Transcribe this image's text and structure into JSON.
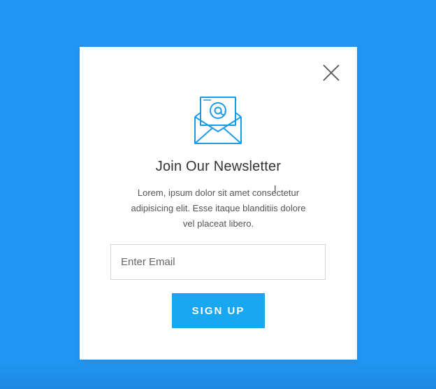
{
  "popup": {
    "title": "Join Our Newsletter",
    "description_lines": [
      "Lorem, ipsum dolor sit amet consectetur",
      "adipisicing elit. Esse itaque blanditiis dolore",
      "vel placeat libero."
    ],
    "email_placeholder": "Enter Email",
    "email_value": "",
    "signup_label": "SIGN UP",
    "icon": "envelope-at-icon",
    "close_icon": "close-icon"
  },
  "colors": {
    "background": "#2196F3",
    "card": "#FFFFFF",
    "button": "#19A7F2",
    "icon_stroke": "#1E9BE6"
  }
}
